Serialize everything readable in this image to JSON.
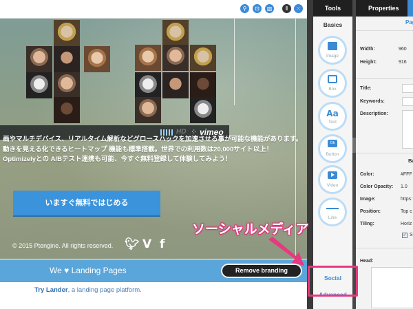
{
  "toolbar": {
    "icons": [
      "pin-icon",
      "lock-icon",
      "trash-icon",
      "columns-icon",
      "grid-icon"
    ],
    "accent": "#3d8ad8"
  },
  "hero": {
    "video_bar": {
      "hd_label": "HD",
      "four_label": "⁘",
      "brand": "vimeo"
    },
    "text_lines": [
      "画やマルチデバイス、リアルタイム解析などグロースハックを加速させる事が可能な機能があります。",
      "動きを見える化できるヒートマップ 機能も標準搭載。世界での利用数は20,000サイト以上！",
      "Optimizelyとの A/Bテスト連携も可能、今すぐ無料登録して体験してみよう！"
    ],
    "cta_label": "いますぐ無料ではじめる",
    "copyright": "© 2015 Ptengine. All rights reserved.",
    "social_icons": [
      "twitter-icon",
      "vine-icon",
      "facebook-icon"
    ]
  },
  "branding": {
    "tagline": "We ♥ Landing Pages",
    "remove_label": "Remove branding",
    "try_link": "Try Lander",
    "try_rest": ", a landing page platform."
  },
  "tools": {
    "title": "Tools",
    "section": "Basics",
    "items": [
      {
        "label": "Image",
        "icon": "image-icon"
      },
      {
        "label": "Box",
        "icon": "box-icon"
      },
      {
        "label": "Text",
        "glyph": "Aa",
        "icon": "text-icon"
      },
      {
        "label": "Button",
        "glyph": "Ok",
        "icon": "button-icon"
      },
      {
        "label": "Video",
        "icon": "video-icon"
      },
      {
        "label": "Line",
        "icon": "line-icon"
      }
    ],
    "social": "Social",
    "advanced": "Advanced"
  },
  "properties": {
    "title": "Properties",
    "tab": "Pag",
    "width_label": "Width:",
    "width_value": "960",
    "height_label": "Height:",
    "height_value": "916",
    "title_label": "Title:",
    "keywords_label": "Keywords:",
    "description_label": "Description:",
    "bg_section": "Ba",
    "color_label": "Color:",
    "color_value": "#FFF",
    "opacity_label": "Color Opacity:",
    "opacity_value": "1.0",
    "image_label": "Image:",
    "image_value": "https:",
    "position_label": "Position:",
    "position_value": "Top c",
    "tiling_label": "Tiling:",
    "tiling_value": "Horiz",
    "check_text": "S",
    "head_label": "Head:"
  },
  "annotation": {
    "text": "ソーシャルメディア",
    "color": "#e8387f"
  }
}
